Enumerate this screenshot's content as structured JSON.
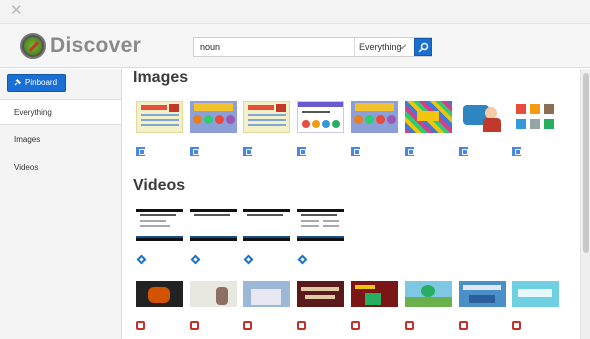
{
  "window": {
    "close_icon": "close-icon"
  },
  "header": {
    "brand": "Discover",
    "search": {
      "value": "noun",
      "placeholder": ""
    },
    "scope": {
      "selected": "Everything"
    },
    "search_icon": "search-icon"
  },
  "sidebar": {
    "pinboard_label": "Pinboard",
    "items": [
      {
        "label": "Everything",
        "active": true
      },
      {
        "label": "Images",
        "active": false
      },
      {
        "label": "Videos",
        "active": false
      }
    ]
  },
  "main": {
    "images_title": "Images",
    "videos_title": "Videos"
  },
  "colors": {
    "accent": "#1a6fd6",
    "google_badge": "#4a86e8",
    "vimeo_badge": "#1a73c6",
    "youtube_badge": "#c4302b"
  }
}
